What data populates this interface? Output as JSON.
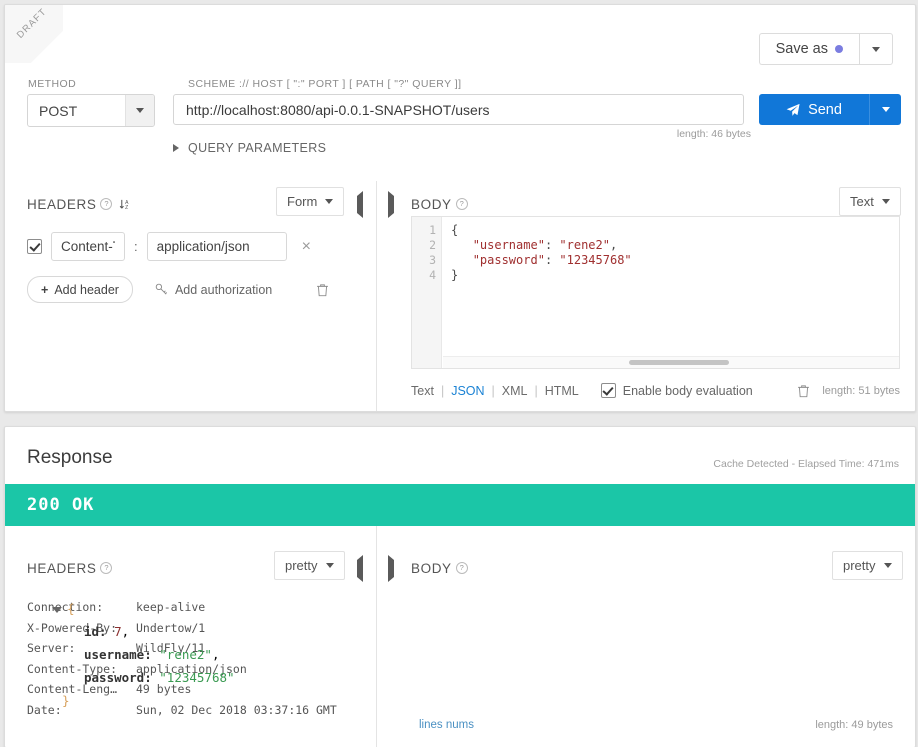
{
  "request": {
    "draft_badge": "DRAFT",
    "save_as_label": "Save as",
    "method_label": "METHOD",
    "method_value": "POST",
    "url_label": "SCHEME :// HOST [ \":\" PORT ] [ PATH [ \"?\" QUERY ]]",
    "url_value": "http://localhost:8080/api-0.0.1-SNAPSHOT/users",
    "url_length": "length: 46 bytes",
    "send_label": "Send",
    "query_params_label": "QUERY PARAMETERS",
    "headers": {
      "title": "HEADERS",
      "help": "?",
      "mode": "Form",
      "rows": [
        {
          "enabled": true,
          "name": "Content-T'",
          "separator": ":",
          "value": "application/json",
          "remove": "×"
        }
      ],
      "add_header_label": "Add header",
      "add_header_plus": "+",
      "add_authorization_label": "Add authorization"
    },
    "body": {
      "title": "BODY",
      "help": "?",
      "mode": "Text",
      "line_numbers": [
        "1",
        "2",
        "3",
        "4"
      ],
      "code_lines": [
        {
          "segments": [
            {
              "t": "{",
              "c": "plain"
            }
          ]
        },
        {
          "segments": [
            {
              "t": "   ",
              "c": "plain"
            },
            {
              "t": "\"username\"",
              "c": "key"
            },
            {
              "t": ": ",
              "c": "plain"
            },
            {
              "t": "\"rene2\"",
              "c": "str"
            },
            {
              "t": ",",
              "c": "plain"
            }
          ]
        },
        {
          "segments": [
            {
              "t": "   ",
              "c": "plain"
            },
            {
              "t": "\"password\"",
              "c": "key"
            },
            {
              "t": ": ",
              "c": "plain"
            },
            {
              "t": "\"12345768\"",
              "c": "str"
            }
          ]
        },
        {
          "segments": [
            {
              "t": "}",
              "c": "plain"
            }
          ]
        }
      ],
      "formats": [
        "Text",
        "JSON",
        "XML",
        "HTML"
      ],
      "active_format": "JSON",
      "enable_eval_label": "Enable body evaluation",
      "enable_eval_checked": true,
      "length": "length: 51 bytes"
    }
  },
  "response": {
    "title": "Response",
    "meta": "Cache Detected - Elapsed Time: 471ms",
    "status": "200  OK",
    "status_color": "#1bc6a7",
    "headers": {
      "title": "HEADERS",
      "help": "?",
      "mode": "pretty",
      "rows": [
        {
          "key": "Connection:",
          "value": "keep-alive"
        },
        {
          "key": "X-Powered-By:",
          "value": "Undertow/1"
        },
        {
          "key": "Server:",
          "value": "WildFly/11"
        },
        {
          "key": "Content-Type:",
          "value": "application/json"
        },
        {
          "key": "Content-Leng…",
          "value": "49 bytes"
        },
        {
          "key": "Date:",
          "value": "Sun, 02 Dec 2018 03:37:16 GMT"
        }
      ]
    },
    "body": {
      "title": "BODY",
      "help": "?",
      "mode": "pretty",
      "open_brace": "{",
      "close_brace": "}",
      "fields": [
        {
          "key": "id:",
          "value": "7",
          "type": "num",
          "comma": ","
        },
        {
          "key": "username:",
          "value": "\"rene2\"",
          "type": "str",
          "comma": ","
        },
        {
          "key": "password:",
          "value": "\"12345768\"",
          "type": "str",
          "comma": ""
        }
      ],
      "lines_nums_label": "lines nums",
      "length": "length: 49 bytes"
    }
  }
}
